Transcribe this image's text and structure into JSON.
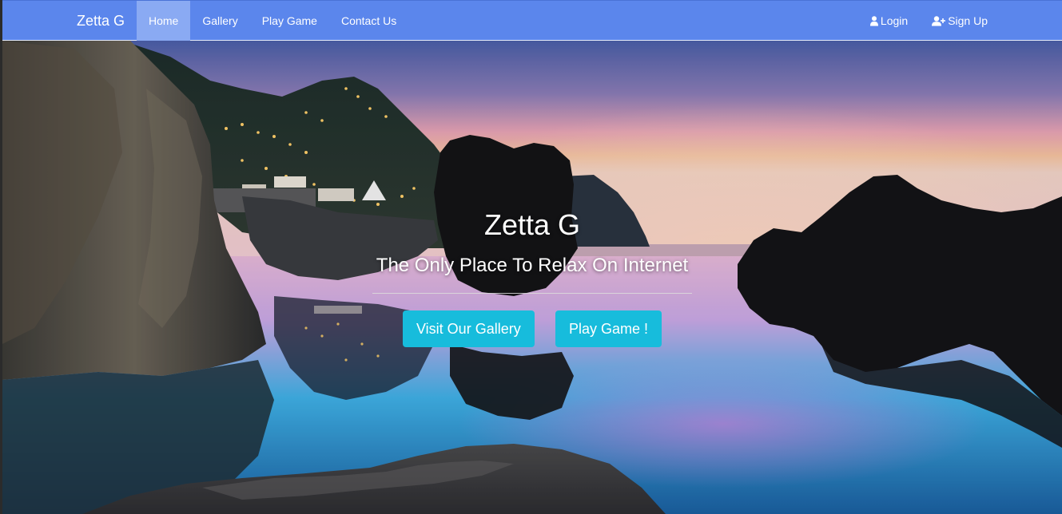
{
  "navbar": {
    "brand": "Zetta G",
    "left_items": [
      {
        "label": "Home",
        "active": true
      },
      {
        "label": "Gallery",
        "active": false
      },
      {
        "label": "Play Game",
        "active": false
      },
      {
        "label": "Contact Us",
        "active": false
      }
    ],
    "right_items": [
      {
        "label": "Login",
        "icon": "user-icon"
      },
      {
        "label": "Sign Up",
        "icon": "user-plus-icon"
      }
    ],
    "colors": {
      "background": "#5b86ec",
      "active": "#8aaaf3"
    }
  },
  "hero": {
    "title": "Zetta G",
    "subtitle": "The Only Place To Relax On Internet",
    "buttons": {
      "gallery": "Visit Our Gallery",
      "game": "Play Game !"
    },
    "button_color": "#17bcdc",
    "background": "coastal lagoon at sunset with rocky cliffs"
  }
}
